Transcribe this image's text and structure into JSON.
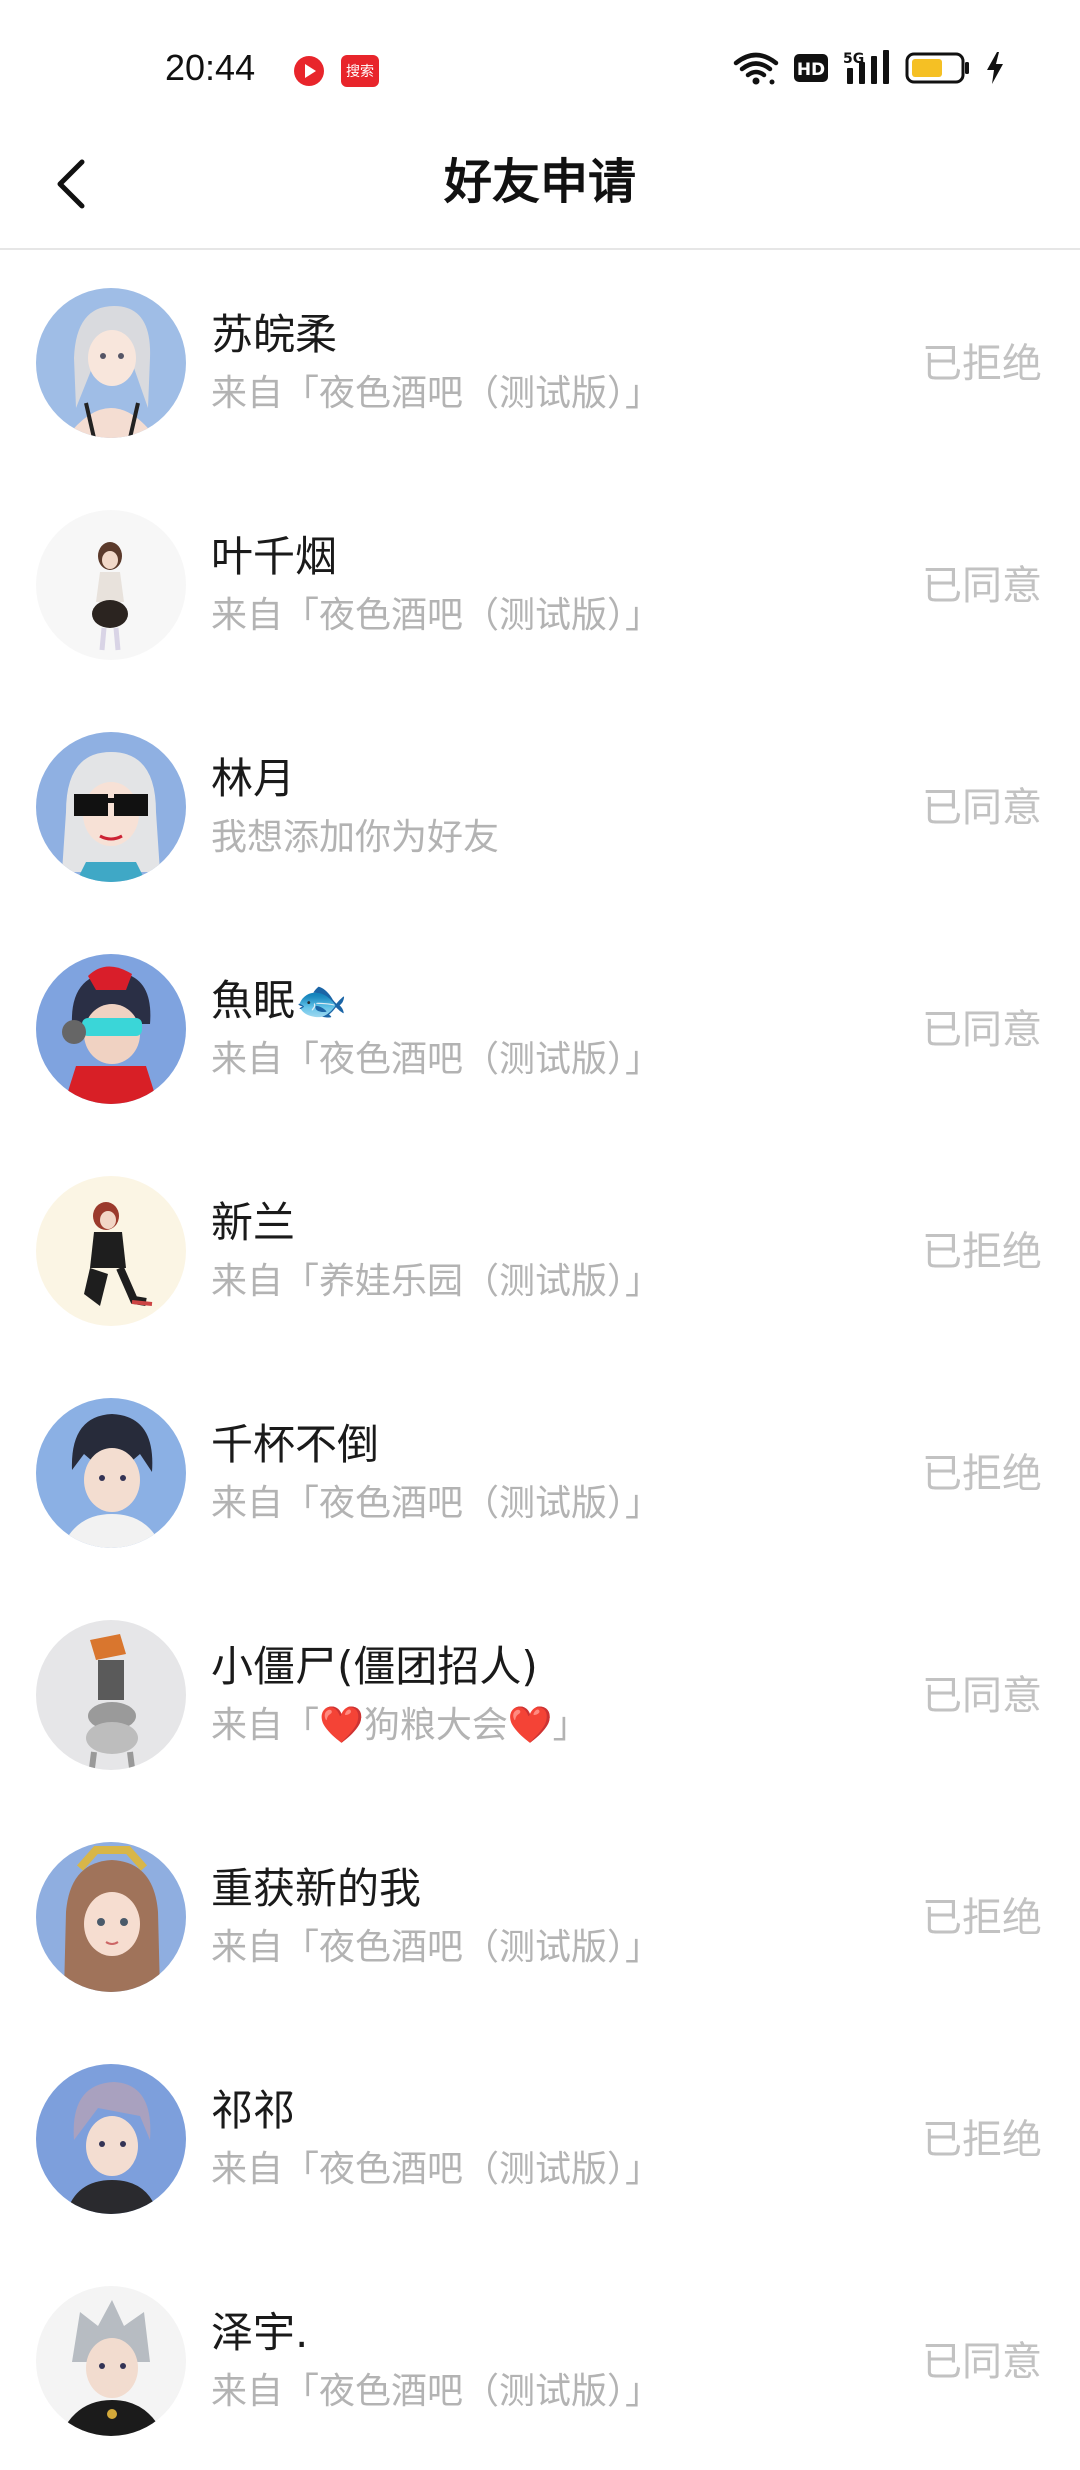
{
  "status_bar": {
    "time": "20:44",
    "search_badge": "搜索",
    "network_badge": "HD",
    "network_type": "5G",
    "battery_color": "#f5c024",
    "icons": [
      "video-app-icon",
      "search-app-icon",
      "wifi-icon",
      "hd-icon",
      "signal-5g-icon",
      "battery-icon",
      "charging-icon"
    ]
  },
  "header": {
    "title": "好友申请",
    "back_icon": "chevron-left-icon"
  },
  "requests": [
    {
      "name": "苏皖柔",
      "source": "来自「夜色酒吧（测试版）」",
      "status": "已拒绝"
    },
    {
      "name": "叶千烟",
      "source": "来自「夜色酒吧（测试版）」",
      "status": "已同意"
    },
    {
      "name": "林月",
      "source": "我想添加你为好友",
      "status": "已同意"
    },
    {
      "name": "魚眠🐟",
      "source": "来自「夜色酒吧（测试版）」",
      "status": "已同意"
    },
    {
      "name": "新兰",
      "source": "来自「养娃乐园（测试版）」",
      "status": "已拒绝"
    },
    {
      "name": "千杯不倒",
      "source": "来自「夜色酒吧（测试版）」",
      "status": "已拒绝"
    },
    {
      "name": "小僵尸(僵团招人)",
      "source": "来自「❤️狗粮大会❤️」",
      "status": "已同意"
    },
    {
      "name": "重获新的我",
      "source": "来自「夜色酒吧（测试版）」",
      "status": "已拒绝"
    },
    {
      "name": "祁祁",
      "source": "来自「夜色酒吧（测试版）」",
      "status": "已拒绝"
    },
    {
      "name": "泽宇.",
      "source": "来自「夜色酒吧（测试版）」",
      "status": "已同意"
    }
  ],
  "colors": {
    "status_text": "#c2c2c2",
    "source_text": "#b3b3b3",
    "name_text": "#1a1a1a",
    "divider": "#e6e6e6"
  }
}
